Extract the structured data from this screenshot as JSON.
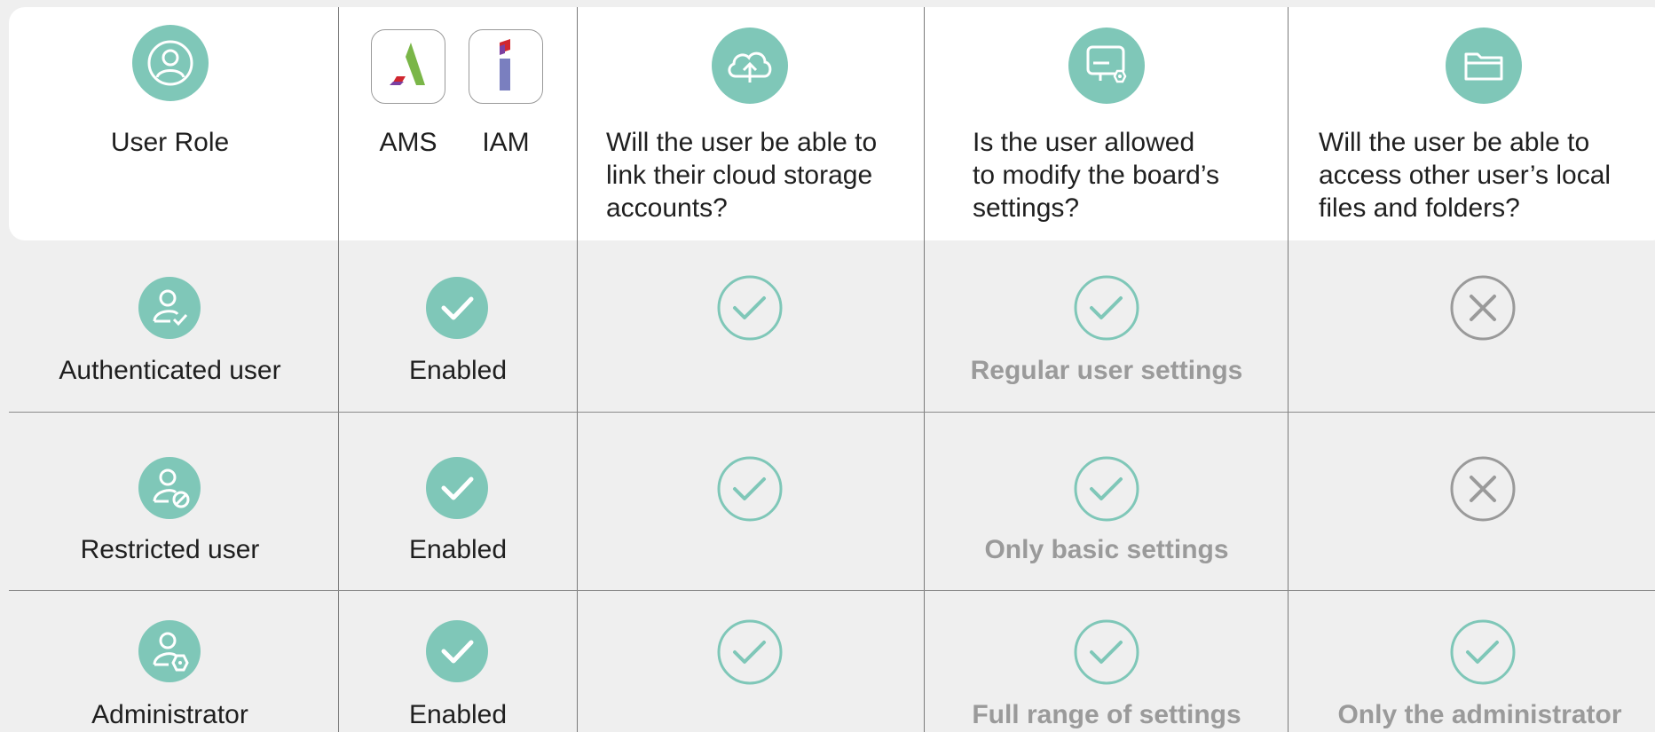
{
  "colors": {
    "accent": "#7fc7b8",
    "muted": "#9a9a9a",
    "cross": "#9a9a9a"
  },
  "header": {
    "role_label": "User Role",
    "ams_label": "AMS",
    "iam_label": "IAM",
    "q_cloud": [
      "Will the user be able to",
      "link their cloud storage",
      "accounts?"
    ],
    "q_settings": [
      "Is the user allowed",
      "to modify the board’s",
      "settings?"
    ],
    "q_files": [
      "Will the user be able to",
      "access other user’s local",
      "files and folders?"
    ]
  },
  "rows": [
    {
      "role": "Authenticated user",
      "role_icon": "user-check-icon",
      "auth_status": "Enabled",
      "cloud": "check",
      "settings": "check",
      "settings_note": "Regular user settings",
      "files": "cross",
      "files_note": ""
    },
    {
      "role": "Restricted user",
      "role_icon": "user-blocked-icon",
      "auth_status": "Enabled",
      "cloud": "check",
      "settings": "check",
      "settings_note": "Only basic settings",
      "files": "cross",
      "files_note": ""
    },
    {
      "role": "Administrator",
      "role_icon": "user-admin-icon",
      "auth_status": "Enabled",
      "cloud": "check",
      "settings": "check",
      "settings_note": "Full range of settings",
      "files": "check",
      "files_note": "Only the administrator"
    }
  ]
}
